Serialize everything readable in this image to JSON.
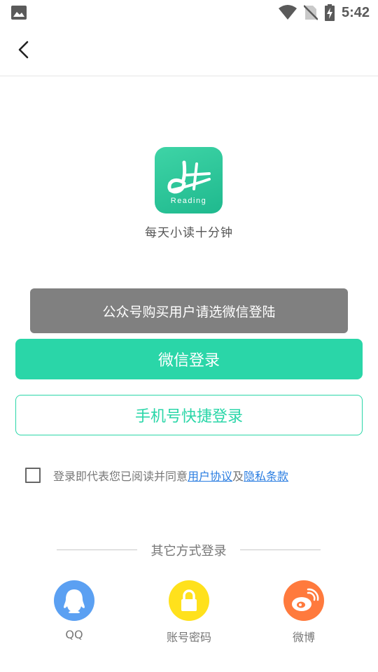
{
  "status_bar": {
    "time": "5:42",
    "icons": [
      "gallery-icon",
      "wifi-icon",
      "no-sim-icon",
      "battery-charging-icon"
    ]
  },
  "header": {
    "back_icon": "back-arrow-icon"
  },
  "app": {
    "logo_text": "Reading",
    "slogan": "每天小读十分钟"
  },
  "toast": {
    "message": "公众号购买用户请选微信登陆"
  },
  "buttons": {
    "wechat_login": "微信登录",
    "phone_login": "手机号快捷登录"
  },
  "agreement": {
    "checked": false,
    "prefix": "登录即代表您已阅读并同意",
    "user_agreement": "用户协议",
    "connector": "及",
    "privacy_policy": "隐私条款"
  },
  "other_login": {
    "title": "其它方式登录",
    "options": [
      {
        "label": "QQ",
        "icon": "qq-icon",
        "color": "#5ba0f2"
      },
      {
        "label": "账号密码",
        "icon": "lock-icon",
        "color": "#ffe11c"
      },
      {
        "label": "微博",
        "icon": "weibo-icon",
        "color": "#ff7a3d"
      }
    ]
  },
  "colors": {
    "accent": "#2ad6a8",
    "link": "#2a7de1",
    "toast_bg": "#808080"
  }
}
